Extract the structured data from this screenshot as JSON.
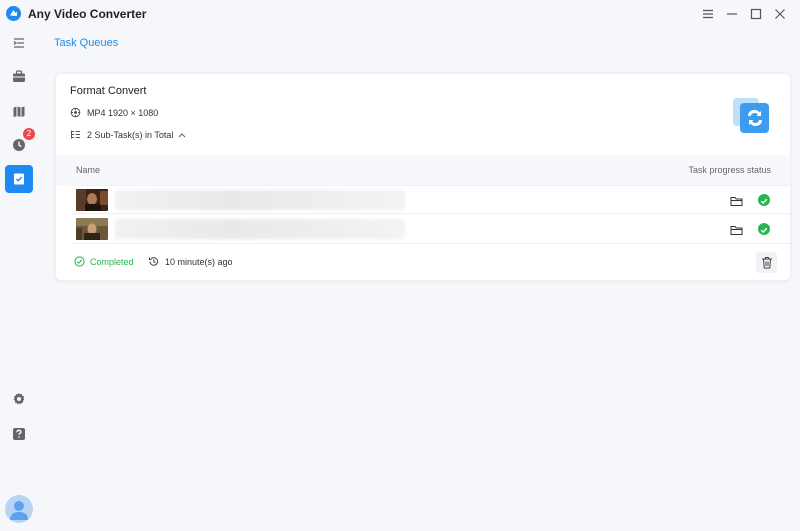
{
  "app": {
    "title": "Any Video Converter"
  },
  "sidebar": {
    "items": [
      {
        "name": "menu",
        "active": false
      },
      {
        "name": "toolbox",
        "active": false
      },
      {
        "name": "map",
        "active": false
      },
      {
        "name": "history",
        "active": false,
        "badge": "2"
      },
      {
        "name": "task-queues",
        "active": true
      }
    ],
    "bottom": [
      "settings",
      "help",
      "avatar"
    ]
  },
  "breadcrumb": {
    "label": "Task Queues"
  },
  "task": {
    "title": "Format Convert",
    "format": "MP4 1920 × 1080",
    "subtasks": "2 Sub-Task(s) in Total",
    "table": {
      "col_name": "Name",
      "col_status": "Task progress status",
      "rows": [
        {
          "filename": ""
        },
        {
          "filename": ""
        }
      ]
    },
    "status": "Completed",
    "time": "10 minute(s) ago"
  },
  "colors": {
    "accent": "#1d8bf1",
    "success": "#27b84d",
    "badge": "#f04848"
  }
}
